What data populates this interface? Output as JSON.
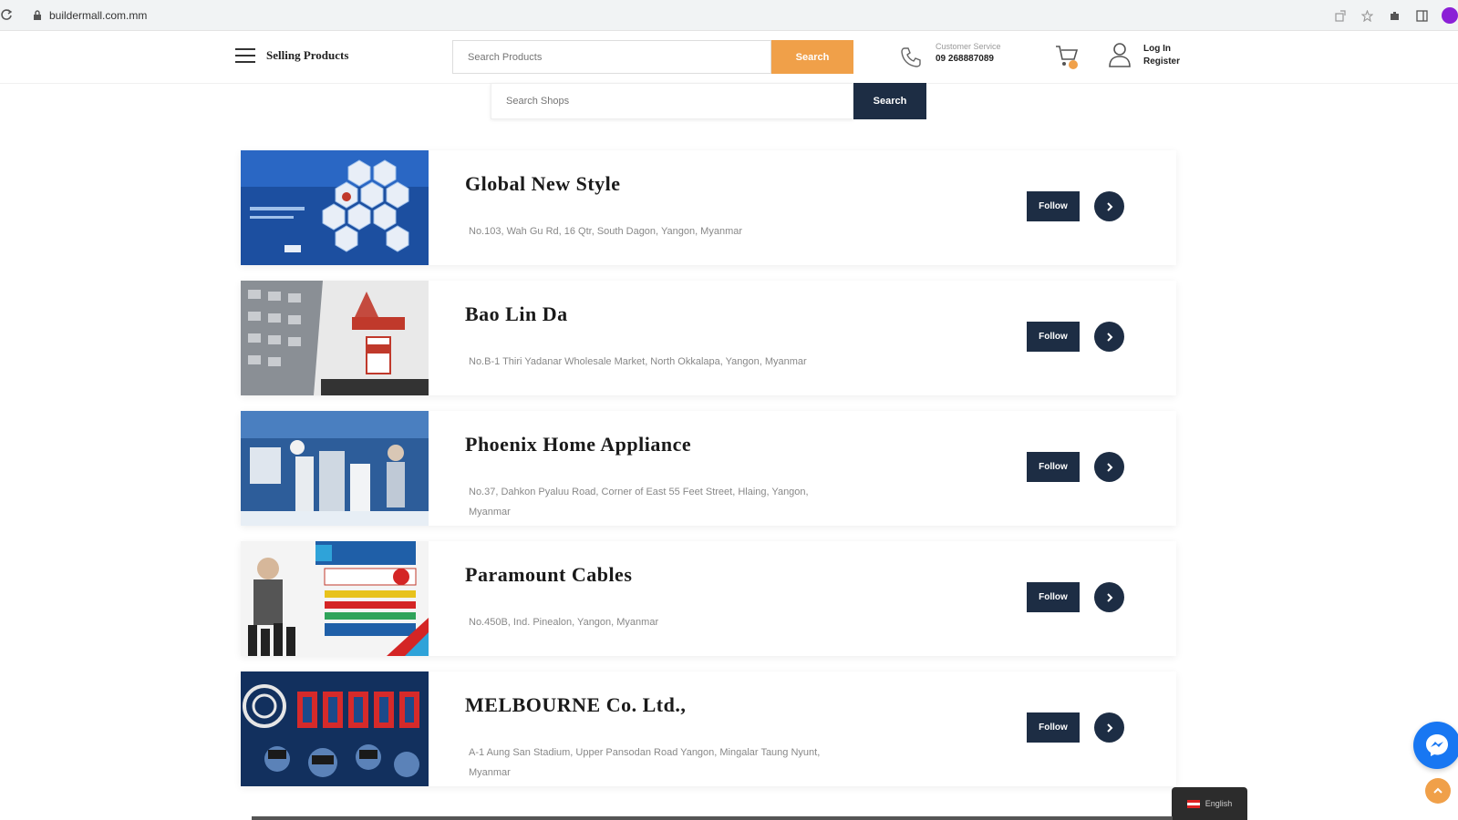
{
  "browser": {
    "url": "buildermall.com.mm"
  },
  "header": {
    "selling_products": "Selling Products",
    "product_search_placeholder": "Search Products",
    "product_search_button": "Search",
    "customer_service_label": "Customer Service",
    "customer_service_number": "09 268887089",
    "login": "Log In",
    "register": "Register"
  },
  "shop_search": {
    "placeholder": "Search Shops",
    "button": "Search"
  },
  "shops": [
    {
      "name": "Global New Style",
      "address": "No.103, Wah Gu Rd, 16 Qtr, South Dagon, Yangon, Myanmar",
      "follow": "Follow"
    },
    {
      "name": "Bao Lin Da",
      "address": "No.B-1 Thiri Yadanar Wholesale Market, North Okkalapa, Yangon, Myanmar",
      "follow": "Follow"
    },
    {
      "name": "Phoenix Home Appliance",
      "address": "No.37, Dahkon Pyaluu Road, Corner of East 55 Feet Street, Hlaing, Yangon, Myanmar",
      "follow": "Follow"
    },
    {
      "name": "Paramount Cables",
      "address": "No.450B, Ind. Pinealon, Yangon, Myanmar",
      "follow": "Follow"
    },
    {
      "name": "MELBOURNE Co. Ltd.,",
      "address": "A-1 Aung San Stadium, Upper Pansodan Road Yangon, Mingalar Taung Nyunt, Myanmar",
      "follow": "Follow"
    }
  ],
  "language": {
    "label": "English"
  },
  "colors": {
    "navy": "#1d2d44",
    "orange": "#f0a049",
    "messenger": "#1877f2"
  }
}
